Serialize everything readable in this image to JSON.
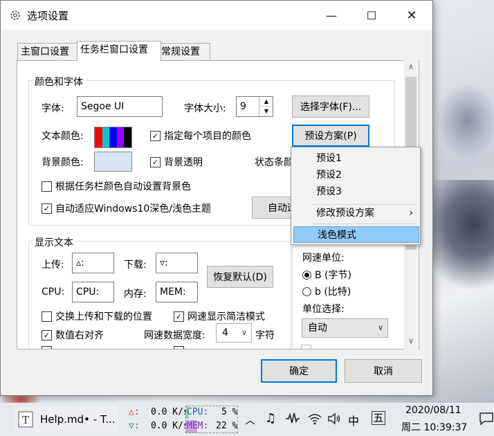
{
  "window": {
    "title": "选项设置",
    "minimize_glyph": "—",
    "maximize_glyph": "☐",
    "close_glyph": "✕"
  },
  "tabs": [
    {
      "label": "主窗口设置",
      "active": false
    },
    {
      "label": "任务栏窗口设置",
      "active": true
    },
    {
      "label": "常规设置",
      "active": false
    }
  ],
  "font_group": {
    "title": "颜色和字体",
    "font_label": "字体:",
    "font_value": "Segoe UI",
    "size_label": "字体大小:",
    "size_value": "9",
    "choose_font_button": "选择字体(F)...",
    "text_color_label": "文本颜色:",
    "text_color_swatches": [
      "#ff0000",
      "#00c8c8",
      "#0000ff",
      "#9900ff",
      "#000000"
    ],
    "per_item_color_checkbox": "指定每个项目的颜色",
    "per_item_color_checked": true,
    "preset_button": "预设方案(P)",
    "bg_color_label": "背景颜色:",
    "bg_color": "#d6e4f2",
    "bg_transparent_checkbox": "背景透明",
    "bg_transparent_checked": true,
    "status_bar_label_partial": "状态条颜",
    "auto_bg_checkbox": "根据任务栏颜色自动设置背景色",
    "auto_bg_checked": false,
    "auto_theme_checkbox": "自动适应Windows10深色/浅色主题",
    "auto_theme_checked": true,
    "auto_button_partial": "自动适"
  },
  "display_group": {
    "title": "显示文本",
    "upload_label": "上传:",
    "upload_value": "▵:",
    "download_label": "下载:",
    "download_value": "▿:",
    "cpu_label": "CPU:",
    "cpu_value": "CPU:",
    "mem_label": "内存:",
    "mem_value": "MEM:",
    "restore_button": "恢复默认(D)",
    "swap_checkbox": "交换上传和下载的位置",
    "swap_checked": false,
    "compact_checkbox": "网速显示简洁模式",
    "compact_checked": true,
    "align_right_checkbox": "数值右对齐",
    "align_right_checked": true,
    "width_label": "网速数据宽度:",
    "width_value": "4",
    "chars_label": "字符"
  },
  "speed_unit": {
    "label": "网速单位:",
    "option_bytes": "B (字节)",
    "option_bits": "b (比特)",
    "selected": "B (字节)",
    "unit_select_label": "单位选择:",
    "unit_select_value": "自动"
  },
  "preset_menu": {
    "items": [
      "预设1",
      "预设2",
      "预设3"
    ],
    "modify": "修改预设方案",
    "modify_arrow": "›",
    "light_mode": "浅色模式"
  },
  "dialog_buttons": {
    "ok": "确定",
    "cancel": "取消"
  },
  "taskbar": {
    "app_label": "Help.md• - T...",
    "up_arrow": "△:",
    "down_arrow": "▽:",
    "up_speed": "0.0 K/s",
    "down_speed": "0.0 K/s",
    "cpu_label": "CPU:",
    "cpu_value": "5 %",
    "cpu_fraction": 0.05,
    "mem_label": "MEM:",
    "mem_value": "22 %",
    "mem_fraction": 0.22,
    "ime_lang": "中",
    "ime_mode": "五",
    "date": "2020/08/11",
    "time": "周二 10:39:37"
  }
}
